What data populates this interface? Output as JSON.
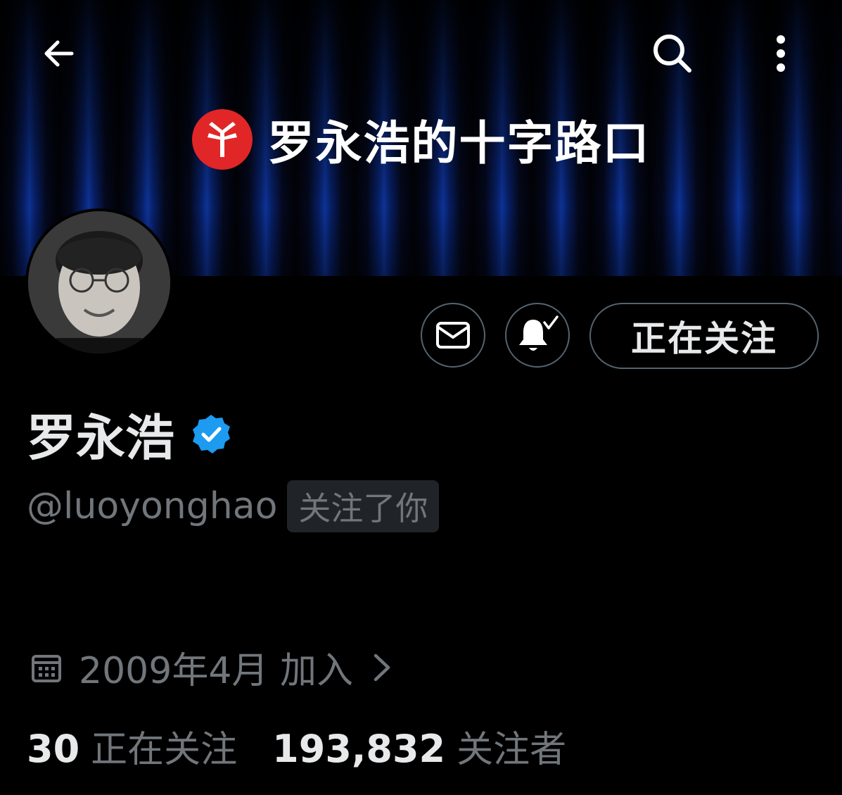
{
  "banner": {
    "title": "罗永浩的十字路口"
  },
  "nav": {
    "back_icon": "arrow-left-icon",
    "search_icon": "search-icon",
    "more_icon": "more-vertical-icon"
  },
  "actions": {
    "message_icon": "mail-icon",
    "notify_icon": "bell-check-icon",
    "follow_label": "正在关注"
  },
  "profile": {
    "display_name": "罗永浩",
    "verified_color": "#1d9bf0",
    "handle": "@luoyonghao",
    "follows_you_label": "关注了你",
    "joined": "2009年4月 加入"
  },
  "stats": {
    "following_count": "30",
    "following_label": "正在关注",
    "followers_count": "193,832",
    "followers_label": "关注者"
  },
  "colors": {
    "background": "#000000",
    "text_primary": "#e7e9ea",
    "text_secondary": "#71767b",
    "border": "#536471",
    "brand_red": "#e02626"
  }
}
